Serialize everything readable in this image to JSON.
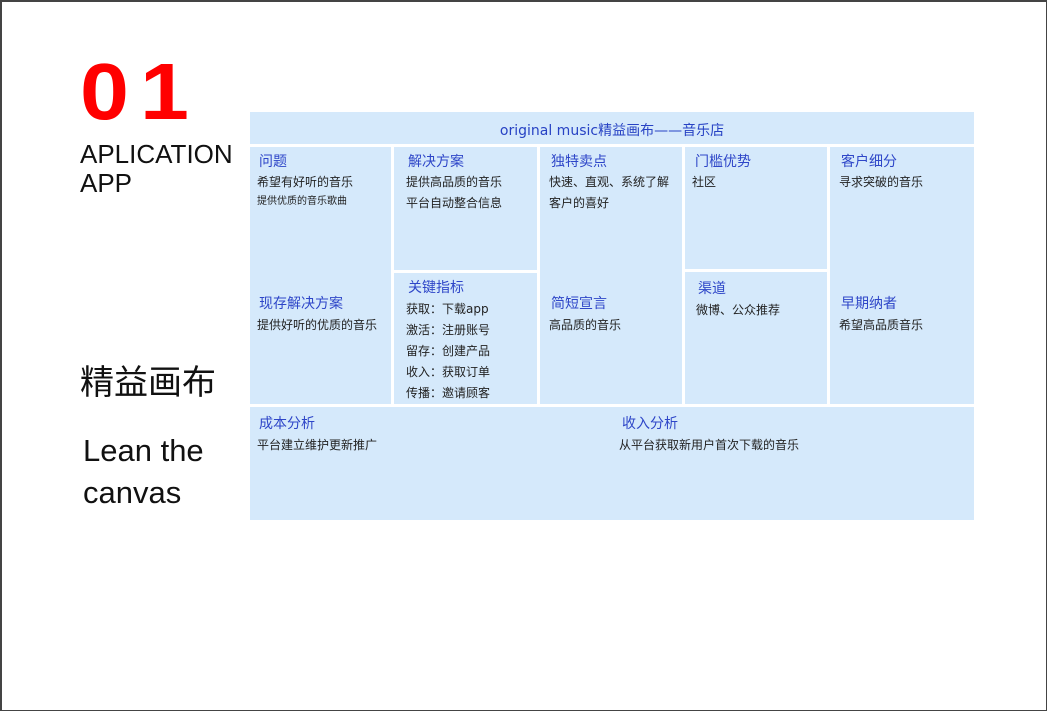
{
  "left": {
    "number": "01",
    "app_line1": "APLICATION",
    "app_line2": "APP",
    "cn_title": "精益画布",
    "en_line1": "Lean the",
    "en_line2": "canvas"
  },
  "canvas": {
    "title": "original music精益画布——音乐店",
    "problem": {
      "label": "问题",
      "lines": [
        "希望有好听的音乐",
        "提供优质的音乐歌曲"
      ]
    },
    "existing": {
      "label": "现存解决方案",
      "lines": [
        "提供好听的优质的音乐"
      ]
    },
    "solution": {
      "label": "解决方案",
      "lines": [
        "提供高品质的音乐",
        "平台自动整合信息"
      ]
    },
    "metrics": {
      "label": "关键指标",
      "lines": [
        "获取：下载app",
        "激活：注册账号",
        "留存：创建产品",
        "收入：获取订单",
        "传播：邀请顾客"
      ]
    },
    "uvp": {
      "label": "独特卖点",
      "lines": [
        "快速、直观、系统了解",
        "客户的喜好"
      ]
    },
    "pitch": {
      "label": "简短宣言",
      "lines": [
        "高品质的音乐"
      ]
    },
    "advantage": {
      "label": "门槛优势",
      "lines": [
        "社区"
      ]
    },
    "channels": {
      "label": "渠道",
      "lines": [
        "微博、公众推荐"
      ]
    },
    "segments": {
      "label": "客户细分",
      "lines": [
        "寻求突破的音乐"
      ]
    },
    "adopters": {
      "label": "早期纳者",
      "lines": [
        "希望高品质音乐"
      ]
    },
    "cost": {
      "label": "成本分析",
      "lines": [
        "平台建立维护更新推广"
      ]
    },
    "revenue": {
      "label": "收入分析",
      "lines": [
        "从平台获取新用户首次下载的音乐"
      ]
    }
  },
  "colors": {
    "cell_bg": "#d5e9fb",
    "label": "#2e46c8",
    "number": "#ff0000"
  }
}
